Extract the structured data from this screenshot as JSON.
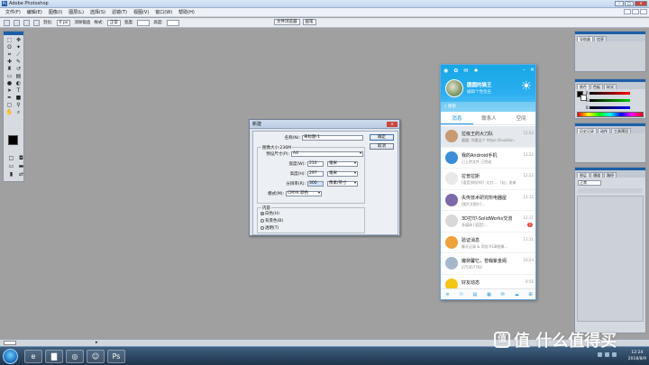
{
  "window": {
    "title": "Adobe Photoshop"
  },
  "menu": [
    "文件(F)",
    "编辑(E)",
    "图像(I)",
    "图层(L)",
    "选择(S)",
    "滤镜(T)",
    "视图(V)",
    "窗口(W)",
    "帮助(H)"
  ],
  "options": {
    "feather_label": "羽化:",
    "feather_value": "0 px",
    "antialias_label": "消除锯齿",
    "style_label": "样式:",
    "style_value": "正常",
    "width_label": "宽度:",
    "height_label": "高度:",
    "tab_filebrowser": "文件浏览器",
    "tab_brushes": "画笔"
  },
  "panels": {
    "navigator_tabs": [
      "导航器",
      "信息"
    ],
    "color_tabs": [
      "颜色",
      "色板",
      "样式"
    ],
    "color_labels": [
      "R",
      "G",
      "B"
    ],
    "history_tabs": [
      "历史记录",
      "动作",
      "工具预设"
    ],
    "layers_tabs": [
      "图层",
      "通道",
      "路径"
    ],
    "layers_mode": "正常"
  },
  "dialog": {
    "title": "新建",
    "name_label": "名称(N):",
    "name_value": "未标题-1",
    "ok": "确定",
    "cancel": "取消",
    "image_size": "图像大小:236M",
    "preset_label": "预设尺寸(P):",
    "preset_value": "A4",
    "width_label": "宽度(W):",
    "width_value": "210",
    "width_unit": "毫米",
    "height_label": "高度(H):",
    "height_value": "297",
    "height_unit": "毫米",
    "res_label": "分辨率(R):",
    "res_value": "300",
    "res_unit": "像素/英寸",
    "mode_label": "模式(M):",
    "mode_value": "CMYK 颜色",
    "content_title": "内容",
    "content_options": [
      "白色(H)",
      "背景色(B)",
      "透明(T)"
    ],
    "content_selected": 0
  },
  "qq": {
    "nickname": "圆圆的猫王",
    "signature": "编辑个性签名",
    "search_placeholder": "搜索",
    "tabs": [
      "消息",
      "联系人",
      "空间"
    ],
    "active_tab": 0,
    "items": [
      {
        "name": "拉级王的大刀队",
        "message": "圆圆: 你看这个 https://kuaikan…",
        "time": "12:23",
        "badge": "",
        "avatar_color": "#c79a6f",
        "selected": true
      },
      {
        "name": "我的Android手机",
        "message": "已上传文件 已完成",
        "time": "12:22",
        "badge": "",
        "avatar_color": "#3a8fd8",
        "selected": false
      },
      {
        "name": "拉普拉斯",
        "message": "[语音]你好吗？大刀… 「幻」发来",
        "time": "12:22",
        "badge": "",
        "avatar_color": "#e8e8e8",
        "selected": false
      },
      {
        "name": "失传技术研究所电器屋",
        "message": "[图片][图片]…",
        "time": "12:12",
        "badge": "",
        "avatar_color": "#7d6aa8",
        "selected": false
      },
      {
        "name": "3D打印-SolidWorks交流",
        "message": "多媒体 [语音]:…",
        "time": "12:11",
        "badge": "2",
        "avatar_color": "#d8d8d8",
        "selected": false
      },
      {
        "name": "验证消息",
        "message": "聊天记录 & 添加 RGB图像…",
        "time": "11:11",
        "badge": "",
        "avatar_color": "#f0a13c",
        "selected": false
      },
      {
        "name": "魔荷馨忆，苍翰紫金阁",
        "message": "275357762",
        "time": "10:24",
        "badge": "",
        "avatar_color": "#a5b8c9",
        "selected": false
      },
      {
        "name": "好友动态",
        "message": "",
        "time": "9:56",
        "badge": "",
        "avatar_color": "#f5c518",
        "selected": false
      }
    ]
  },
  "taskbar": {
    "clock_time": "12:24",
    "clock_date": "2018/8/9"
  },
  "watermark": "值 什么值得买"
}
